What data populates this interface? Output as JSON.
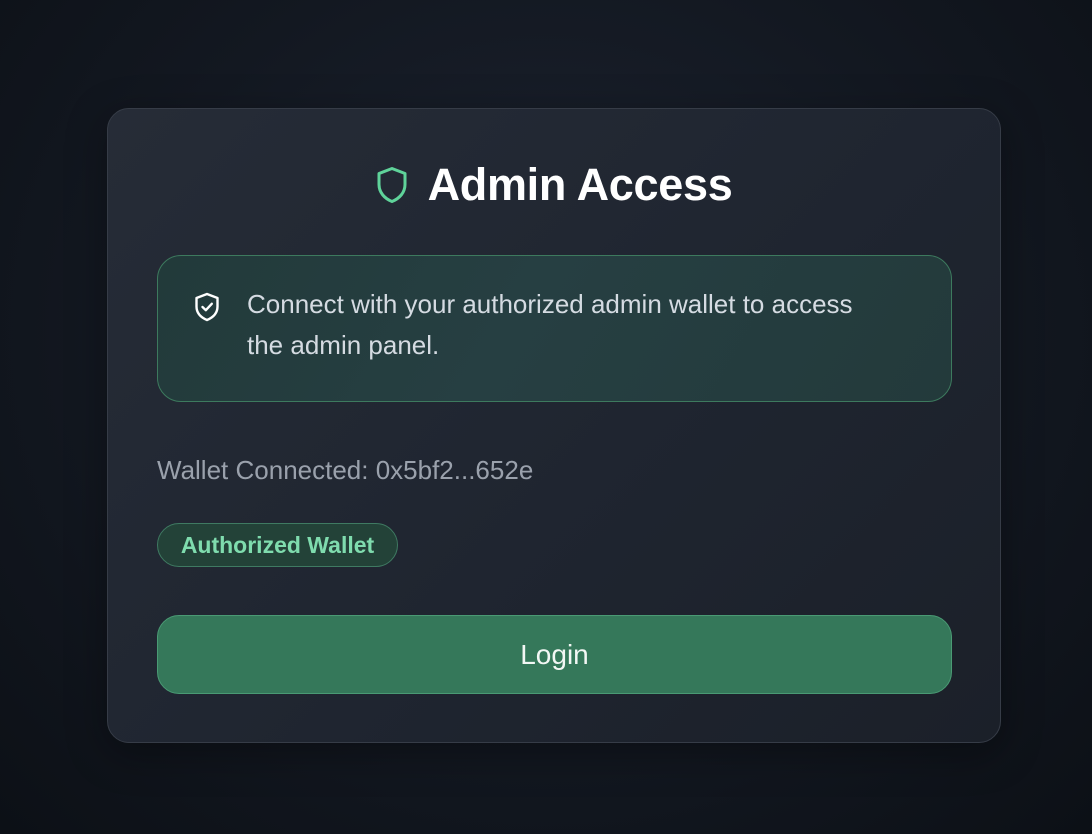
{
  "header": {
    "title": "Admin Access",
    "icon": "shield-icon"
  },
  "info": {
    "icon": "shield-check-icon",
    "text": "Connect with your authorized admin wallet to access the admin panel."
  },
  "wallet": {
    "status_text": "Wallet Connected: 0x5bf2...652e"
  },
  "badge": {
    "label": "Authorized Wallet"
  },
  "actions": {
    "login_label": "Login"
  },
  "colors": {
    "accent": "#5fd39a",
    "button_bg": "#35785a",
    "badge_text": "#7fdcae",
    "background": "#131821",
    "card_bg": "#222833"
  }
}
